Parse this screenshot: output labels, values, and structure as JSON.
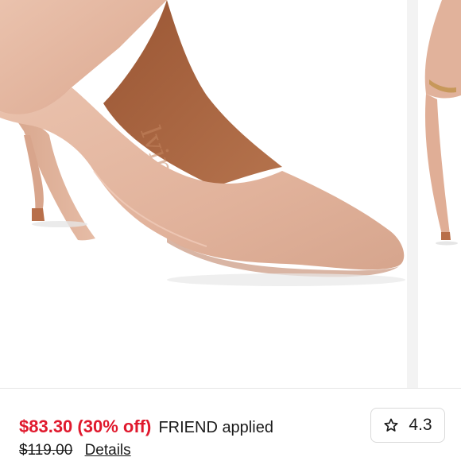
{
  "carousel": {
    "main_image": "beige-pointed-toe-pump",
    "next_image": "pump-partial-peek",
    "colors": {
      "shoe": "#e3b69f",
      "shoe_shadow": "#c9967e",
      "lining": "#a9653f",
      "heel_tip": "#b86f4a",
      "divider": "#f3f3f3"
    }
  },
  "price": {
    "sale_price": "$83.30",
    "discount": "(30% off)",
    "promo": "FRIEND applied",
    "original_price": "$119.00",
    "details_link": "Details",
    "sale_color": "#e0192d"
  },
  "rating": {
    "icon": "star-outline-icon",
    "value": "4.3"
  }
}
